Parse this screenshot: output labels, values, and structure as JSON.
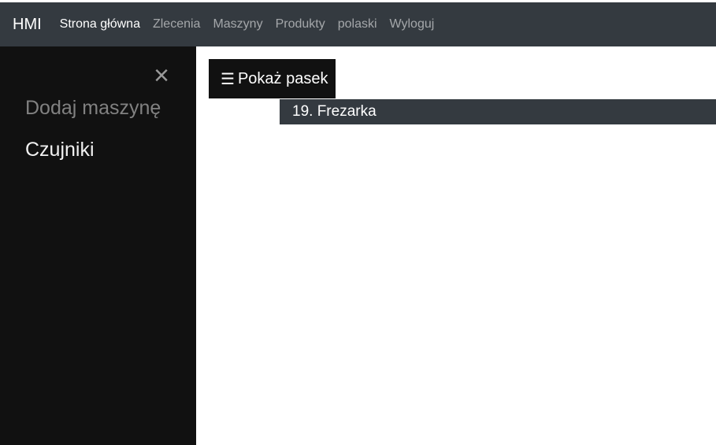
{
  "navbar": {
    "brand": "HMI",
    "links": [
      {
        "label": "Strona główna",
        "active": true
      },
      {
        "label": "Zlecenia",
        "active": false
      },
      {
        "label": "Maszyny",
        "active": false
      },
      {
        "label": "Produkty",
        "active": false
      },
      {
        "label": "polaski",
        "active": false
      },
      {
        "label": "Wyloguj",
        "active": false
      }
    ]
  },
  "sidebar": {
    "close_icon": "×",
    "items": [
      {
        "label": "Dodaj maszynę"
      },
      {
        "label": "Czujniki"
      }
    ]
  },
  "main": {
    "toggle_icon": "☰",
    "toggle_label": "Pokaż pasek",
    "machine_title": "19. Frezarka"
  },
  "colors": {
    "navbar_bg": "#343a40",
    "sidebar_bg": "#111111",
    "machine_bar_bg": "#343a40"
  }
}
